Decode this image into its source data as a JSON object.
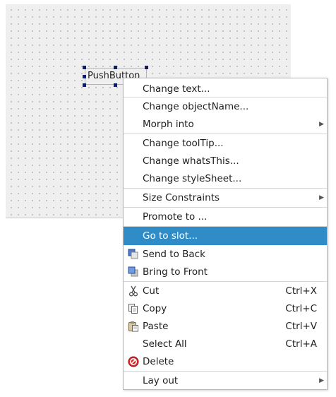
{
  "form": {
    "push_button_text": "PushButton"
  },
  "menu": {
    "change_text": "Change text...",
    "change_object_name": "Change objectName...",
    "morph_into": "Morph into",
    "change_tooltip": "Change toolTip...",
    "change_whats_this": "Change whatsThis...",
    "change_stylesheet": "Change styleSheet...",
    "size_constraints": "Size Constraints",
    "promote_to": "Promote to ...",
    "go_to_slot": "Go to slot...",
    "send_to_back": "Send to Back",
    "bring_to_front": "Bring to Front",
    "cut": "Cut",
    "cut_shortcut": "Ctrl+X",
    "copy": "Copy",
    "copy_shortcut": "Ctrl+C",
    "paste": "Paste",
    "paste_shortcut": "Ctrl+V",
    "select_all": "Select All",
    "select_all_shortcut": "Ctrl+A",
    "delete": "Delete",
    "lay_out": "Lay out",
    "submenu_arrow": "▶"
  },
  "icons": {
    "send_to_back": "send-to-back-icon",
    "bring_to_front": "bring-to-front-icon",
    "cut": "scissors-icon",
    "copy": "copy-icon",
    "paste": "paste-icon",
    "delete": "delete-icon"
  },
  "colors": {
    "selection": "#308cc6",
    "handle": "#0a1e78",
    "delete_red": "#d42a2a"
  }
}
